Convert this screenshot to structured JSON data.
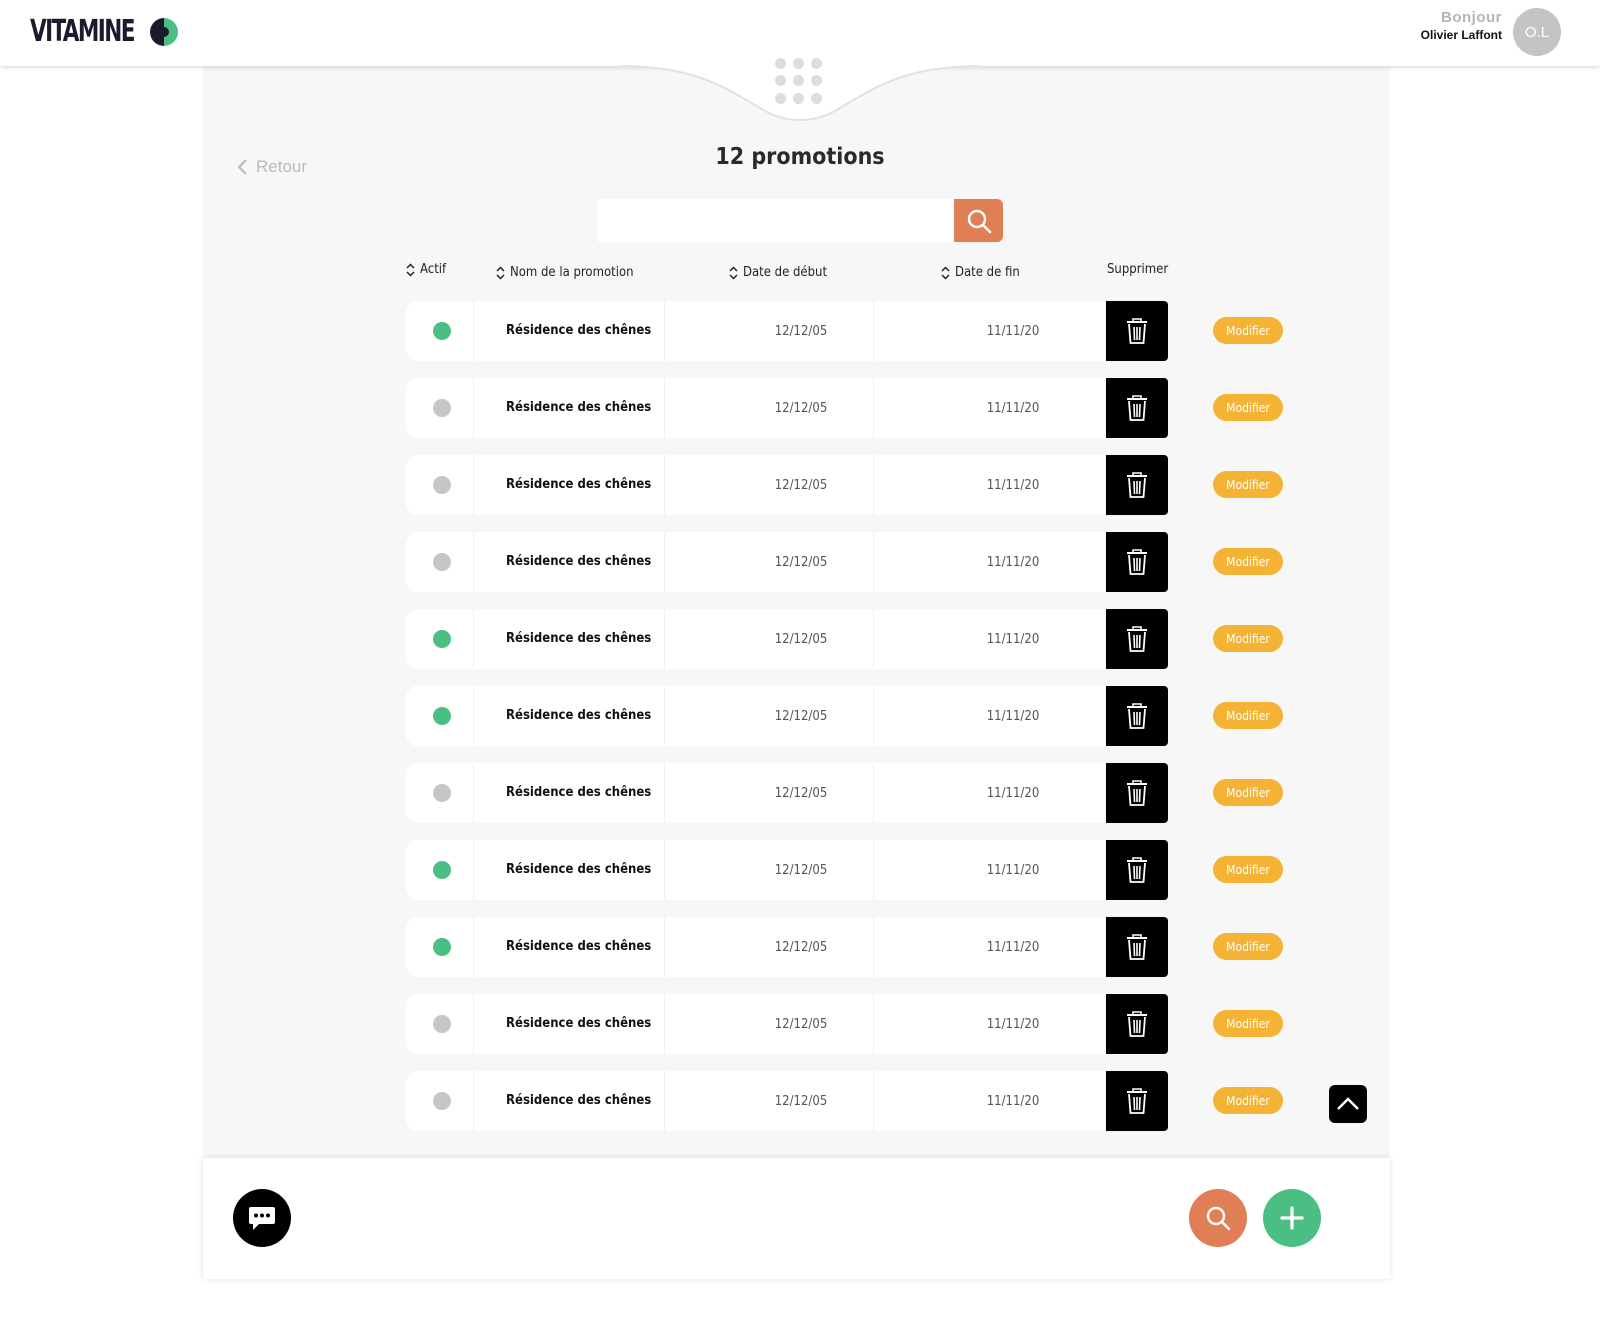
{
  "header": {
    "brand": "VITAMINE",
    "greeting": "Bonjour",
    "user_name": "Olivier Laffont",
    "avatar_initials": "O.L"
  },
  "nav": {
    "back_label": "Retour"
  },
  "page": {
    "title": "12 promotions"
  },
  "search": {
    "value": "",
    "placeholder": ""
  },
  "table": {
    "columns": {
      "active": "Actif",
      "name": "Nom de la promotion",
      "start": "Date de début",
      "end": "Date de fin",
      "delete": "Supprimer"
    },
    "modify_label": "Modifier",
    "rows": [
      {
        "active": true,
        "name": "Résidence des chênes",
        "start": "12/12/05",
        "end": "11/11/20"
      },
      {
        "active": false,
        "name": "Résidence des chênes",
        "start": "12/12/05",
        "end": "11/11/20"
      },
      {
        "active": false,
        "name": "Résidence des chênes",
        "start": "12/12/05",
        "end": "11/11/20"
      },
      {
        "active": false,
        "name": "Résidence des chênes",
        "start": "12/12/05",
        "end": "11/11/20"
      },
      {
        "active": true,
        "name": "Résidence des chênes",
        "start": "12/12/05",
        "end": "11/11/20"
      },
      {
        "active": true,
        "name": "Résidence des chênes",
        "start": "12/12/05",
        "end": "11/11/20"
      },
      {
        "active": false,
        "name": "Résidence des chênes",
        "start": "12/12/05",
        "end": "11/11/20"
      },
      {
        "active": true,
        "name": "Résidence des chênes",
        "start": "12/12/05",
        "end": "11/11/20"
      },
      {
        "active": true,
        "name": "Résidence des chênes",
        "start": "12/12/05",
        "end": "11/11/20"
      },
      {
        "active": false,
        "name": "Résidence des chênes",
        "start": "12/12/05",
        "end": "11/11/20"
      },
      {
        "active": false,
        "name": "Résidence des chênes",
        "start": "12/12/05",
        "end": "11/11/20"
      }
    ]
  },
  "colors": {
    "accent_orange": "#e07f55",
    "accent_green": "#4bbf83",
    "modify_yellow": "#f5b335",
    "inactive_grey": "#c6c6c6"
  },
  "icons": {
    "back": "chevron-left-icon",
    "search": "search-icon",
    "sort": "sort-icon",
    "delete": "trash-icon",
    "scroll_top": "chevron-up-icon",
    "chat": "chat-icon",
    "add": "plus-icon",
    "menu": "grid-dots-icon"
  }
}
